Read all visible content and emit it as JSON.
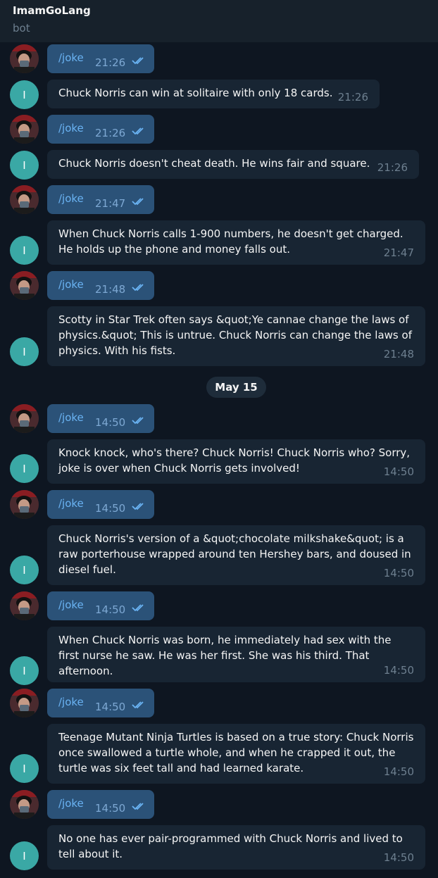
{
  "header": {
    "title": "ImamGoLang",
    "status": "bot"
  },
  "date_divider": "May 15",
  "bot_avatar_initial": "I",
  "colors": {
    "background": "#0e1621",
    "outgoing": "#2b5278",
    "incoming": "#182533",
    "link": "#6ab3f3",
    "bot_avatar": "#3aa8a5"
  },
  "messages": [
    {
      "kind": "out",
      "text": "/joke",
      "time": "21:26",
      "status": "read"
    },
    {
      "kind": "in",
      "text": "Chuck Norris can win at solitaire with only 18 cards.",
      "time": "21:26"
    },
    {
      "kind": "out",
      "text": "/joke",
      "time": "21:26",
      "status": "read"
    },
    {
      "kind": "in",
      "text": "Chuck Norris doesn't cheat death. He wins fair and square.",
      "time": "21:26"
    },
    {
      "kind": "out",
      "text": "/joke",
      "time": "21:47",
      "status": "read"
    },
    {
      "kind": "in",
      "text": "When Chuck Norris calls 1-900 numbers, he doesn't get charged. He holds up the phone and money falls out.",
      "time": "21:47"
    },
    {
      "kind": "out",
      "text": "/joke",
      "time": "21:48",
      "status": "read"
    },
    {
      "kind": "in",
      "text": "Scotty in Star Trek often says &quot;Ye cannae change the laws of physics.&quot; This is untrue. Chuck Norris can change the laws of physics. With his fists.",
      "time": "21:48"
    },
    {
      "kind": "out",
      "text": "/joke",
      "time": "14:50",
      "status": "read"
    },
    {
      "kind": "in",
      "text": "Knock knock, who's there? Chuck Norris! Chuck Norris who? Sorry, joke is over when Chuck Norris gets involved!",
      "time": "14:50"
    },
    {
      "kind": "out",
      "text": "/joke",
      "time": "14:50",
      "status": "read"
    },
    {
      "kind": "in",
      "text": "Chuck Norris's version of a &quot;chocolate milkshake&quot; is a raw porterhouse wrapped around ten Hershey bars, and doused in diesel fuel.",
      "time": "14:50"
    },
    {
      "kind": "out",
      "text": "/joke",
      "time": "14:50",
      "status": "read"
    },
    {
      "kind": "in",
      "text": "When Chuck Norris was born, he immediately had sex with the first nurse he saw. He was her first. She was his third. That afternoon.",
      "time": "14:50"
    },
    {
      "kind": "out",
      "text": "/joke",
      "time": "14:50",
      "status": "read"
    },
    {
      "kind": "in",
      "text": "Teenage Mutant Ninja Turtles is based on a true story: Chuck Norris once swallowed a turtle whole, and when he crapped it out, the turtle was six feet tall and had learned karate.",
      "time": "14:50"
    },
    {
      "kind": "out",
      "text": "/joke",
      "time": "14:50",
      "status": "read"
    },
    {
      "kind": "in",
      "text": "No one has ever pair-programmed with Chuck Norris and lived to tell about it.",
      "time": "14:50"
    }
  ]
}
